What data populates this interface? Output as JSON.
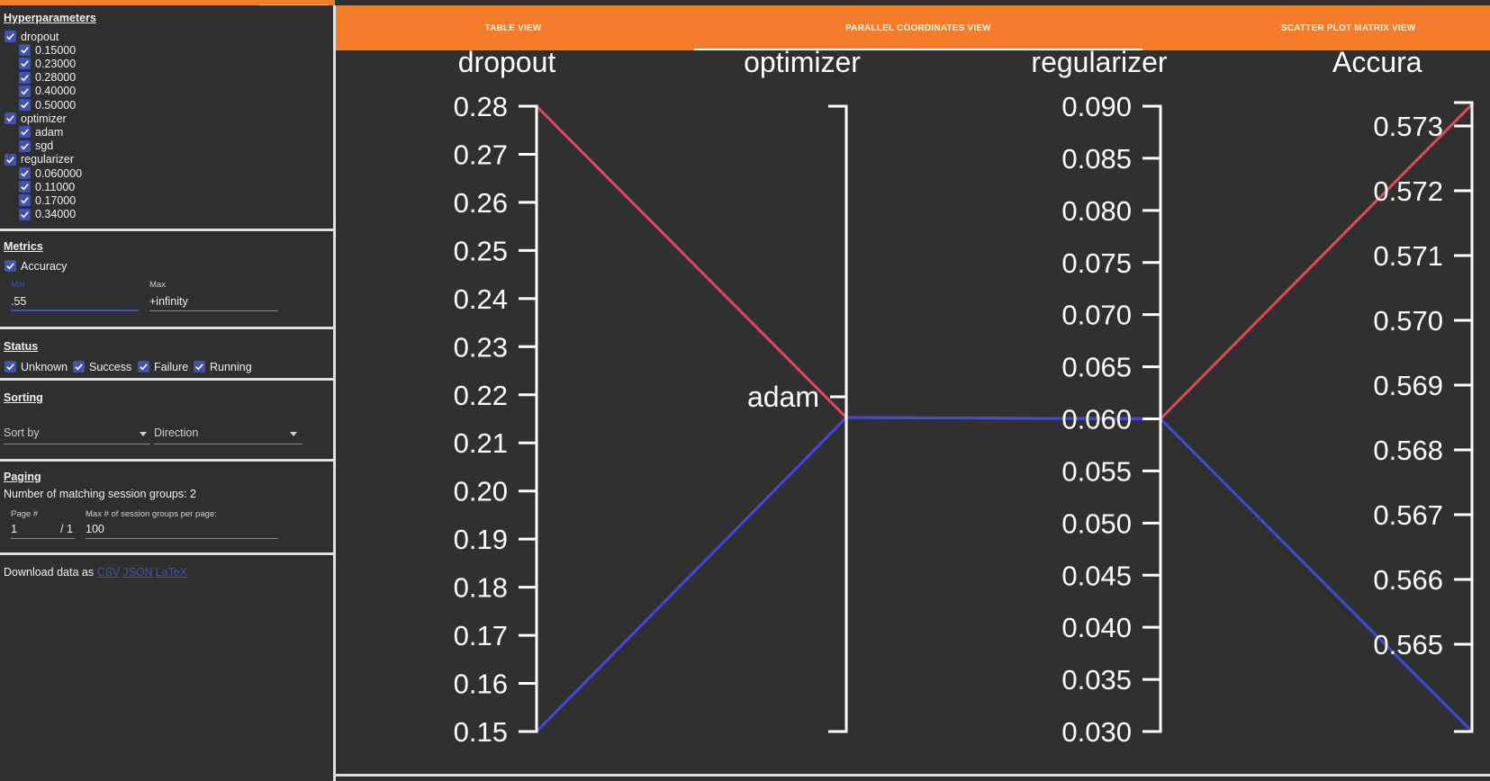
{
  "sidebar": {
    "hyperparameters": {
      "title": "Hyperparameters",
      "groups": [
        {
          "name": "dropout",
          "values": [
            "0.15000",
            "0.23000",
            "0.28000",
            "0.40000",
            "0.50000"
          ]
        },
        {
          "name": "optimizer",
          "values": [
            "adam",
            "sgd"
          ]
        },
        {
          "name": "regularizer",
          "values": [
            "0.060000",
            "0.11000",
            "0.17000",
            "0.34000"
          ]
        }
      ]
    },
    "metrics": {
      "title": "Metrics",
      "metric": "Accuracy",
      "min_label": "Min",
      "min_value": ".55",
      "max_label": "Max",
      "max_value": "+infinity"
    },
    "status": {
      "title": "Status",
      "items": [
        "Unknown",
        "Success",
        "Failure",
        "Running"
      ]
    },
    "sorting": {
      "title": "Sorting",
      "sort_by": "Sort by",
      "direction": "Direction"
    },
    "paging": {
      "title": "Paging",
      "matching_text": "Number of matching session groups: 2",
      "page_label": "Page #",
      "page_value": "1",
      "page_total": "/ 1",
      "max_label": "Max # of session groups per page:",
      "max_value": "100"
    },
    "download": {
      "text": "Download data as",
      "links": [
        "CSV",
        "JSON",
        "LaTeX"
      ]
    }
  },
  "tabs": [
    "TABLE VIEW",
    "PARALLEL COORDINATES VIEW",
    "SCATTER PLOT MATRIX VIEW"
  ],
  "active_tab": "PARALLEL COORDINATES VIEW",
  "colors": {
    "accent": "#f57c2b",
    "checkbox": "#3f51b5",
    "line_red": "#e0485c",
    "line_blue": "#4346e0"
  },
  "chart_data": {
    "type": "parallel_coordinates",
    "axes": [
      {
        "name": "dropout",
        "kind": "numeric",
        "range": [
          0.15,
          0.28
        ],
        "ticks": [
          "0.28",
          "0.27",
          "0.26",
          "0.25",
          "0.24",
          "0.23",
          "0.22",
          "0.21",
          "0.20",
          "0.19",
          "0.18",
          "0.17",
          "0.16",
          "0.15"
        ]
      },
      {
        "name": "optimizer",
        "kind": "categorical",
        "categories": [
          "adam"
        ]
      },
      {
        "name": "regularizer",
        "kind": "numeric",
        "range": [
          0.03,
          0.09
        ],
        "ticks": [
          "0.090",
          "0.085",
          "0.080",
          "0.075",
          "0.070",
          "0.065",
          "0.060",
          "0.055",
          "0.050",
          "0.045",
          "0.040",
          "0.035",
          "0.030"
        ]
      },
      {
        "name": "Accura",
        "kind": "numeric",
        "range": [
          0.5645,
          0.5735
        ],
        "ticks": [
          "0.573",
          "0.572",
          "0.571",
          "0.570",
          "0.569",
          "0.568",
          "0.567",
          "0.566",
          "0.565"
        ]
      }
    ],
    "series": [
      {
        "color": "#e0485c",
        "values": [
          0.28,
          "adam",
          0.06,
          0.5735
        ]
      },
      {
        "color": "#4346e0",
        "values": [
          0.15,
          "adam",
          0.06,
          0.5645
        ]
      }
    ]
  }
}
